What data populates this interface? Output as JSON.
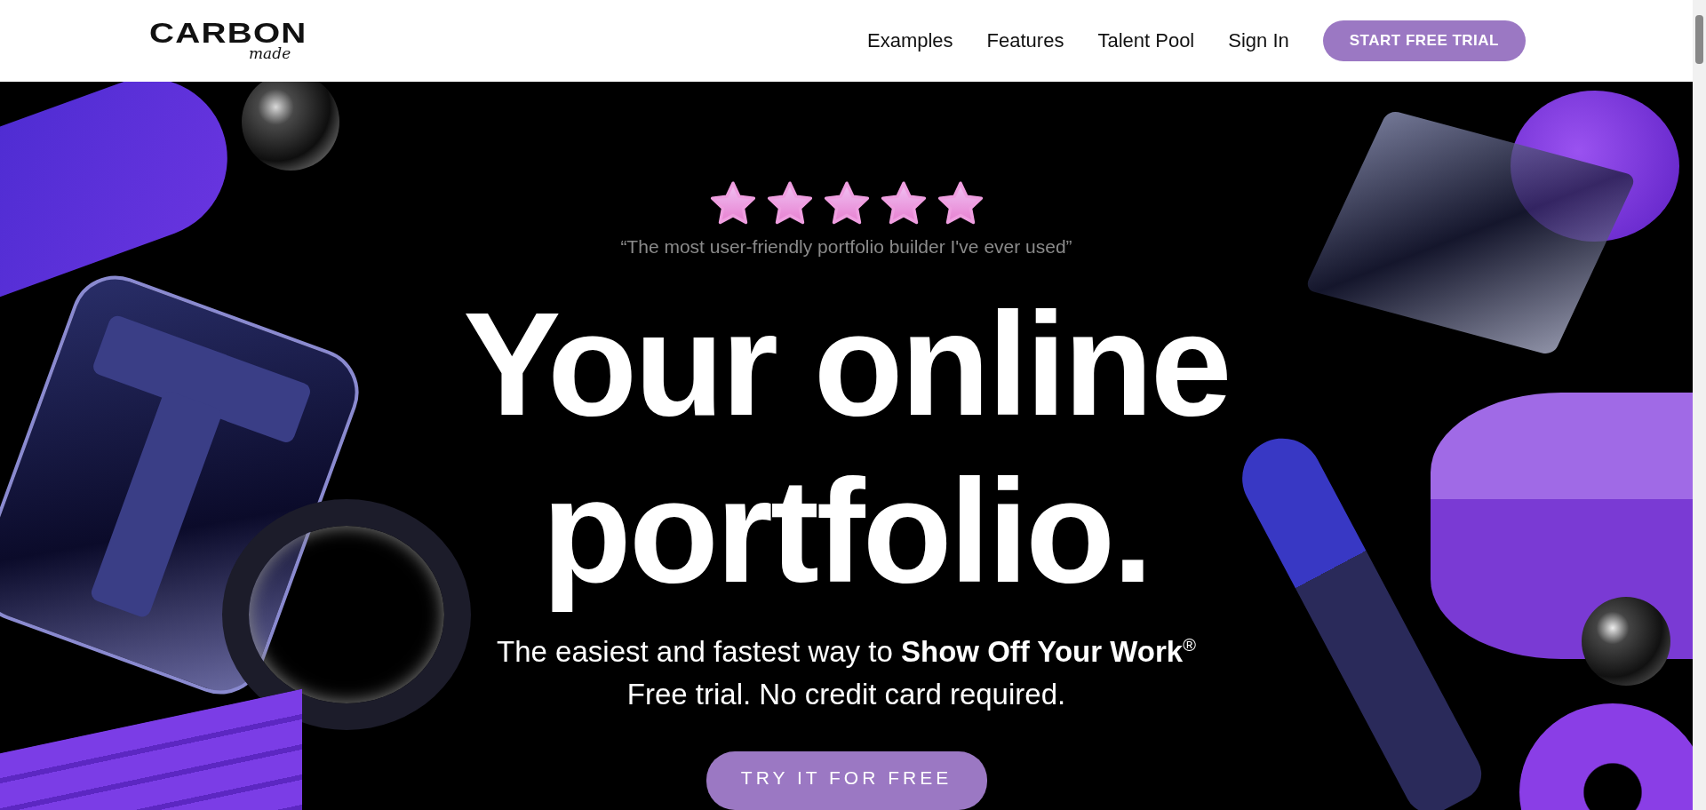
{
  "header": {
    "logo": {
      "word": "CARBON",
      "script": "made"
    },
    "nav": [
      {
        "label": "Examples"
      },
      {
        "label": "Features"
      },
      {
        "label": "Talent Pool"
      },
      {
        "label": "Sign In"
      }
    ],
    "cta": "START FREE TRIAL"
  },
  "hero": {
    "rating": {
      "stars": 5
    },
    "quote": "“The most user-friendly portfolio builder I've ever used”",
    "headline": [
      "Your online",
      "portfolio."
    ],
    "subtitle": "The easiest and fastest way to **Show Off Your Work**$^{®}$",
    "note": "Free trial. No credit card required.",
    "button": "TRY IT FOR FREE"
  }
}
